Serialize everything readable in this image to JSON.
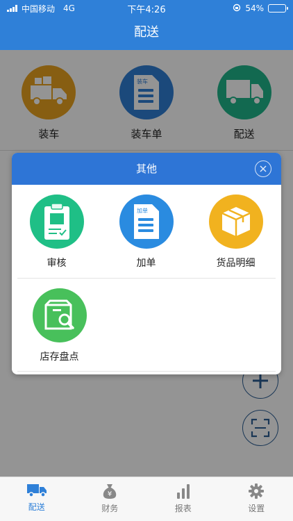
{
  "status_bar": {
    "carrier": "中国移动",
    "network": "4G",
    "time": "下午4:26",
    "battery": "54%",
    "battery_level": 0.54
  },
  "header": {
    "title": "配送"
  },
  "main_grid": [
    {
      "label": "装车",
      "icon": "truck-boxes-icon",
      "color": "#e9a21f"
    },
    {
      "label": "装车单",
      "icon": "document-icon",
      "color": "#2f7fd4",
      "icon_text": "装车"
    },
    {
      "label": "配送",
      "icon": "van-icon",
      "color": "#1fb68a"
    }
  ],
  "modal": {
    "title": "其他",
    "items": [
      {
        "label": "审核",
        "icon": "clipboard-check-icon",
        "color": "#1fbf86"
      },
      {
        "label": "加单",
        "icon": "document-icon",
        "color": "#2a8be0",
        "icon_text": "加单"
      },
      {
        "label": "货品明细",
        "icon": "box-icon",
        "color": "#f1b21f"
      },
      {
        "label": "店存盘点",
        "icon": "inventory-search-icon",
        "color": "#48c05b"
      }
    ]
  },
  "tabbar": {
    "items": [
      {
        "label": "配送",
        "icon": "truck-icon",
        "active": true
      },
      {
        "label": "财务",
        "icon": "money-bag-icon",
        "active": false,
        "icon_text": "¥"
      },
      {
        "label": "报表",
        "icon": "bar-chart-icon",
        "active": false
      },
      {
        "label": "设置",
        "icon": "gear-icon",
        "active": false
      }
    ]
  },
  "colors": {
    "primary": "#2f80d8",
    "modal_header": "#2e75d6",
    "tab_active": "#2f80d8",
    "tab_inactive": "#888888"
  }
}
